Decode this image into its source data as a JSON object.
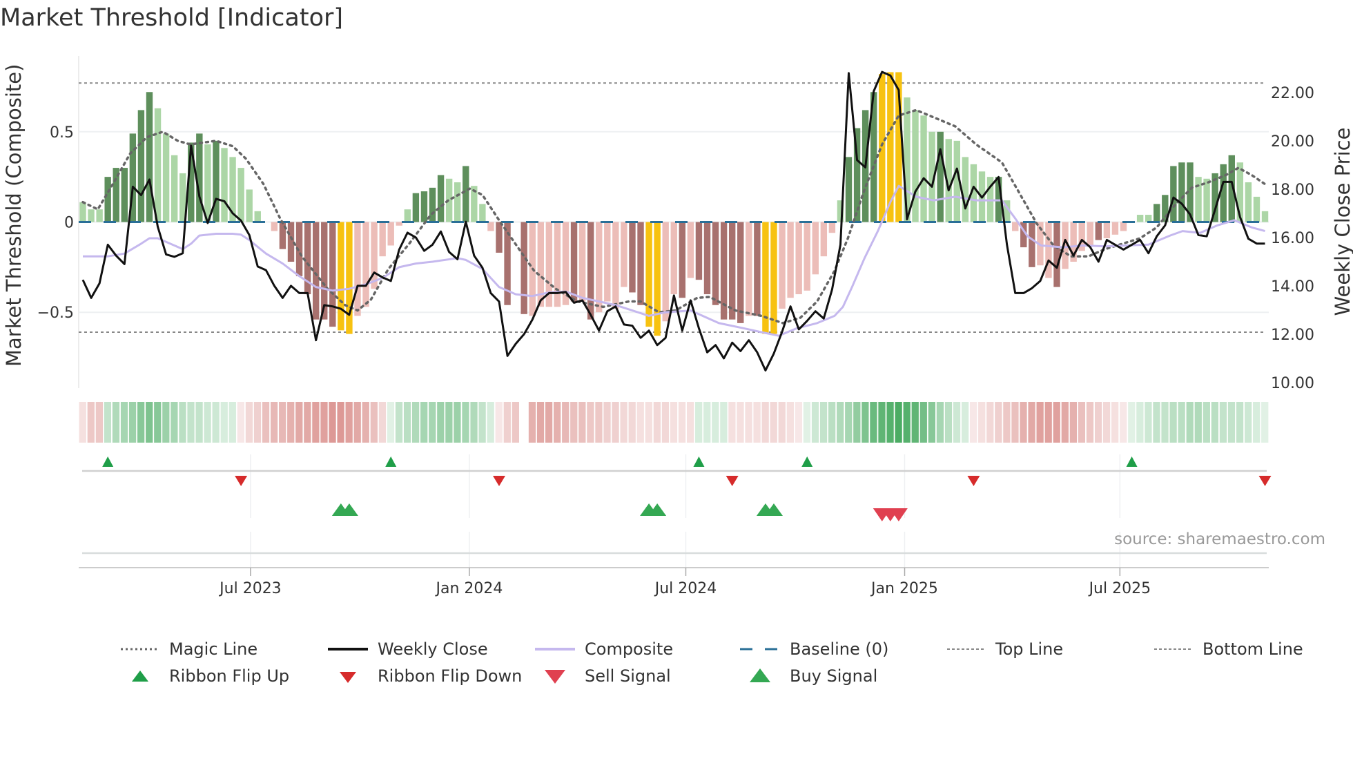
{
  "title": "Market Threshold [Indicator]",
  "source": "source: sharemaestro.com",
  "colors": {
    "bar_dark_green": "#5e8f5c",
    "bar_light_green": "#acd6a6",
    "bar_dark_red": "#a8716e",
    "bar_light_red": "#ecbdb8",
    "bar_yellow": "#f7c211",
    "weekly_close": "#111111",
    "composite": "#c5b8ee",
    "magic_line": "#666666",
    "baseline": "#2a6f97",
    "threshold_lines": "#888888",
    "ribbon_green": "#2e9e4a",
    "ribbon_red": "#c85a55",
    "flip_up": "#1f9e48",
    "flip_down": "#d62b2b",
    "sell": "#e04050",
    "buy": "#34a853"
  },
  "chart_data": {
    "type": "bar+line",
    "title": "Market Threshold [Indicator]",
    "ylabel_left": "Market Threshold (Composite)",
    "ylabel_right": "Weekly Close Price",
    "ylim_left": [
      -0.92,
      0.92
    ],
    "ylim_right": [
      9.77,
      23.51
    ],
    "yticks_left": [
      {
        "value": 0.5,
        "label": "0.5"
      },
      {
        "value": 0,
        "label": "0"
      },
      {
        "value": -0.5,
        "label": "−0.5"
      }
    ],
    "yticks_right": [
      {
        "value": 22,
        "label": "22.00"
      },
      {
        "value": 20,
        "label": "20.00"
      },
      {
        "value": 18,
        "label": "18.00"
      },
      {
        "value": 16,
        "label": "16.00"
      },
      {
        "value": 14,
        "label": "14.00"
      },
      {
        "value": 12,
        "label": "12.00"
      },
      {
        "value": 10,
        "label": "10.00"
      }
    ],
    "xticks": [
      {
        "label": "Jul 2023",
        "date": "2023-07-01"
      },
      {
        "label": "Jan 2024",
        "date": "2024-01-01"
      },
      {
        "label": "Jul 2024",
        "date": "2024-07-01"
      },
      {
        "label": "Jan 2025",
        "date": "2025-01-01"
      },
      {
        "label": "Jul 2025",
        "date": "2025-07-01"
      }
    ],
    "start_date": "2023-02-10",
    "frequency": "weekly",
    "top_line": 0.77,
    "bottom_line": -0.61,
    "baseline": 0,
    "histogram": [
      0.11,
      0.07,
      0.07,
      0.25,
      0.3,
      0.3,
      0.49,
      0.62,
      0.72,
      0.63,
      0.49,
      0.37,
      0.27,
      0.44,
      0.49,
      0.43,
      0.45,
      0.41,
      0.36,
      0.3,
      0.18,
      0.06,
      0,
      -0.05,
      -0.15,
      -0.22,
      -0.3,
      -0.4,
      -0.54,
      -0.54,
      -0.58,
      -0.6,
      -0.62,
      -0.52,
      -0.47,
      -0.37,
      -0.19,
      -0.13,
      -0.02,
      0.07,
      0.16,
      0.17,
      0.19,
      0.26,
      0.24,
      0.22,
      0.31,
      0.2,
      0.1,
      -0.05,
      -0.17,
      -0.46,
      0,
      -0.51,
      -0.52,
      -0.47,
      -0.47,
      -0.47,
      -0.46,
      -0.44,
      -0.44,
      -0.54,
      -0.5,
      -0.44,
      -0.48,
      -0.36,
      -0.39,
      -0.46,
      -0.58,
      -0.63,
      -0.55,
      -0.4,
      -0.42,
      -0.31,
      -0.32,
      -0.4,
      -0.46,
      -0.54,
      -0.54,
      -0.56,
      -0.52,
      -0.52,
      -0.62,
      -0.62,
      -0.48,
      -0.42,
      -0.4,
      -0.38,
      -0.29,
      -0.19,
      -0.06,
      0.12,
      0.36,
      0.52,
      0.62,
      0.72,
      0.82,
      0.83,
      0.83,
      0.69,
      0.62,
      0.59,
      0.5,
      0.5,
      0.46,
      0.45,
      0.36,
      0.32,
      0.28,
      0.25,
      0.25,
      0.12,
      -0.05,
      -0.14,
      -0.25,
      -0.24,
      -0.31,
      -0.36,
      -0.26,
      -0.22,
      -0.16,
      -0.13,
      -0.1,
      -0.09,
      -0.07,
      -0.05,
      0,
      0.04,
      0.04,
      0.1,
      0.15,
      0.31,
      0.33,
      0.33,
      0.25,
      0.24,
      0.27,
      0.32,
      0.37,
      0.33,
      0.22,
      0.14,
      0.06
    ],
    "histogram_shade": "LLLDDDDDDLLLLDDLDLLLLL-LDDDDDDDYYLLLLLLLDDDDLLDLLLDD-DLLLLLDLDLLLLDDYYLLDLDDDDDDLDYYLLLLLLLLDDDDYYYLLLLDLLLLLLDLLDDLLDLLLLDLLL-LLDDDDDLLDDDLLLL",
    "weekly_close": [
      14.25,
      13.5,
      14.1,
      15.7,
      15.25,
      14.9,
      18.1,
      17.75,
      18.4,
      16.45,
      15.3,
      15.2,
      15.35,
      19.8,
      17.7,
      16.6,
      17.6,
      17.5,
      17.0,
      16.7,
      16.1,
      14.8,
      14.65,
      14.0,
      13.5,
      14.0,
      13.7,
      13.7,
      11.75,
      13.2,
      13.15,
      13.05,
      12.8,
      14.0,
      14.0,
      14.55,
      14.35,
      14.2,
      15.5,
      16.2,
      16.0,
      15.45,
      15.7,
      16.25,
      15.4,
      15.1,
      16.65,
      15.25,
      14.75,
      13.7,
      13.35,
      11.1,
      11.6,
      12.0,
      12.6,
      13.4,
      13.7,
      13.7,
      13.75,
      13.3,
      13.4,
      12.8,
      12.15,
      12.95,
      13.15,
      12.4,
      12.35,
      11.85,
      12.15,
      11.55,
      11.85,
      13.6,
      12.15,
      13.4,
      12.25,
      11.25,
      11.55,
      11.0,
      11.65,
      11.3,
      11.75,
      11.25,
      10.5,
      11.2,
      12.1,
      13.15,
      12.2,
      12.55,
      12.95,
      12.65,
      13.85,
      15.7,
      22.8,
      19.2,
      18.9,
      22.05,
      22.85,
      22.7,
      22.1,
      16.75,
      17.9,
      18.45,
      18.1,
      19.65,
      17.95,
      18.85,
      17.2,
      18.1,
      17.65,
      18.1,
      18.5,
      15.7,
      13.7,
      13.7,
      13.9,
      14.2,
      15.05,
      14.75,
      15.9,
      15.25,
      15.9,
      15.6,
      15.0,
      15.9,
      15.7,
      15.5,
      15.7,
      15.9,
      15.35,
      16.05,
      16.5,
      17.65,
      17.4,
      16.95,
      16.1,
      16.05,
      17.15,
      18.3,
      18.3,
      16.85,
      15.95,
      15.75,
      15.75
    ],
    "composite": [
      [
        0,
        -0.19
      ],
      [
        3,
        -0.19
      ],
      [
        5,
        -0.175
      ],
      [
        7,
        -0.12
      ],
      [
        8,
        -0.09
      ],
      [
        9,
        -0.09
      ],
      [
        11,
        -0.13
      ],
      [
        12,
        -0.15
      ],
      [
        13,
        -0.12
      ],
      [
        14,
        -0.075
      ],
      [
        16,
        -0.065
      ],
      [
        18,
        -0.065
      ],
      [
        19,
        -0.07
      ],
      [
        20,
        -0.1
      ],
      [
        22,
        -0.175
      ],
      [
        24,
        -0.23
      ],
      [
        26,
        -0.3
      ],
      [
        28,
        -0.36
      ],
      [
        30,
        -0.38
      ],
      [
        32,
        -0.37
      ],
      [
        34,
        -0.345
      ],
      [
        36,
        -0.31
      ],
      [
        38,
        -0.25
      ],
      [
        40,
        -0.23
      ],
      [
        42,
        -0.22
      ],
      [
        45,
        -0.2
      ],
      [
        46,
        -0.21
      ],
      [
        48,
        -0.26
      ],
      [
        50,
        -0.36
      ],
      [
        52,
        -0.4
      ],
      [
        54,
        -0.41
      ],
      [
        56,
        -0.39
      ],
      [
        58,
        -0.385
      ],
      [
        60,
        -0.42
      ],
      [
        62,
        -0.44
      ],
      [
        64,
        -0.46
      ],
      [
        66,
        -0.49
      ],
      [
        68,
        -0.52
      ],
      [
        70,
        -0.5
      ],
      [
        73,
        -0.49
      ],
      [
        76.4,
        -0.56
      ],
      [
        79.5,
        -0.59
      ],
      [
        81.5,
        -0.61
      ],
      [
        83.6,
        -0.63
      ],
      [
        85.7,
        -0.59
      ],
      [
        88.2,
        -0.56
      ],
      [
        90.3,
        -0.52
      ],
      [
        91.3,
        -0.47
      ],
      [
        92.4,
        -0.36
      ],
      [
        93.9,
        -0.2
      ],
      [
        95.5,
        -0.05
      ],
      [
        97,
        0.11
      ],
      [
        98,
        0.2
      ],
      [
        100.1,
        0.14
      ],
      [
        102.2,
        0.12
      ],
      [
        104.8,
        0.14
      ],
      [
        107.3,
        0.12
      ],
      [
        110.4,
        0.12
      ],
      [
        112,
        0.02
      ],
      [
        113.5,
        -0.08
      ],
      [
        115.1,
        -0.13
      ],
      [
        117.7,
        -0.14
      ],
      [
        120.2,
        -0.13
      ],
      [
        122.8,
        -0.135
      ],
      [
        125.4,
        -0.13
      ],
      [
        128,
        -0.125
      ],
      [
        130.6,
        -0.075
      ],
      [
        132.1,
        -0.05
      ],
      [
        134.2,
        -0.06
      ],
      [
        136.2,
        -0.02
      ],
      [
        138.3,
        0.01
      ],
      [
        140.4,
        -0.03
      ],
      [
        142,
        -0.05
      ]
    ],
    "magic_line": [
      [
        0,
        0.11
      ],
      [
        1.8,
        0.07
      ],
      [
        3.6,
        0.21
      ],
      [
        5.7,
        0.38
      ],
      [
        7.7,
        0.47
      ],
      [
        9.6,
        0.5
      ],
      [
        11.4,
        0.45
      ],
      [
        12.9,
        0.43
      ],
      [
        16,
        0.45
      ],
      [
        18,
        0.42
      ],
      [
        19.6,
        0.35
      ],
      [
        21.7,
        0.21
      ],
      [
        23.7,
        0.02
      ],
      [
        26.3,
        -0.19
      ],
      [
        29.4,
        -0.37
      ],
      [
        31.5,
        -0.46
      ],
      [
        33,
        -0.49
      ],
      [
        34.6,
        -0.43
      ],
      [
        36.7,
        -0.26
      ],
      [
        39.2,
        -0.12
      ],
      [
        41.8,
        0.04
      ],
      [
        43.9,
        0.12
      ],
      [
        46.5,
        0.185
      ],
      [
        48,
        0.15
      ],
      [
        50,
        0.01
      ],
      [
        52.1,
        -0.13
      ],
      [
        54.2,
        -0.27
      ],
      [
        56.8,
        -0.37
      ],
      [
        59.4,
        -0.44
      ],
      [
        62.5,
        -0.47
      ],
      [
        65.6,
        -0.44
      ],
      [
        67,
        -0.44
      ],
      [
        69.2,
        -0.5
      ],
      [
        71.2,
        -0.49
      ],
      [
        73.8,
        -0.42
      ],
      [
        75.3,
        -0.415
      ],
      [
        78.4,
        -0.49
      ],
      [
        81.5,
        -0.52
      ],
      [
        84.1,
        -0.56
      ],
      [
        86.2,
        -0.53
      ],
      [
        88.2,
        -0.44
      ],
      [
        90.3,
        -0.27
      ],
      [
        91.9,
        -0.09
      ],
      [
        93.9,
        0.18
      ],
      [
        96,
        0.43
      ],
      [
        98,
        0.59
      ],
      [
        100.1,
        0.62
      ],
      [
        102.2,
        0.58
      ],
      [
        104.8,
        0.53
      ],
      [
        107.3,
        0.43
      ],
      [
        110.4,
        0.33
      ],
      [
        112.5,
        0.16
      ],
      [
        114.6,
        -0.01
      ],
      [
        116.6,
        -0.13
      ],
      [
        118.7,
        -0.19
      ],
      [
        120.8,
        -0.19
      ],
      [
        122.8,
        -0.15
      ],
      [
        124.9,
        -0.12
      ],
      [
        127,
        -0.09
      ],
      [
        129,
        -0.03
      ],
      [
        131.1,
        0.09
      ],
      [
        133.2,
        0.19
      ],
      [
        135.2,
        0.22
      ],
      [
        137.3,
        0.26
      ],
      [
        138.8,
        0.3
      ],
      [
        140.4,
        0.26
      ],
      [
        142,
        0.21
      ]
    ],
    "ribbon": [
      -0.2,
      -0.35,
      -0.35,
      0.3,
      0.4,
      0.45,
      0.5,
      0.6,
      0.65,
      0.6,
      0.5,
      0.45,
      0.35,
      0.3,
      0.3,
      0.25,
      0.25,
      0.2,
      0.2,
      -0.15,
      -0.25,
      -0.3,
      -0.4,
      -0.45,
      -0.45,
      -0.5,
      -0.55,
      -0.55,
      -0.6,
      -0.6,
      -0.65,
      -0.65,
      -0.6,
      -0.55,
      -0.5,
      -0.4,
      -0.25,
      0.15,
      0.3,
      0.35,
      0.4,
      0.45,
      0.45,
      0.5,
      0.5,
      0.5,
      0.45,
      0.4,
      0.3,
      0.2,
      -0.15,
      -0.3,
      -0.35,
      null,
      -0.5,
      -0.55,
      -0.55,
      -0.5,
      -0.45,
      -0.4,
      -0.4,
      -0.35,
      -0.35,
      -0.3,
      -0.3,
      -0.25,
      -0.25,
      -0.2,
      -0.2,
      -0.25,
      -0.25,
      -0.2,
      -0.2,
      -0.2,
      0.2,
      0.2,
      0.2,
      0.2,
      -0.2,
      -0.2,
      -0.2,
      -0.2,
      -0.25,
      -0.25,
      -0.25,
      -0.2,
      -0.15,
      0.15,
      0.25,
      0.3,
      0.35,
      0.4,
      0.45,
      0.55,
      0.65,
      0.75,
      0.8,
      0.85,
      0.9,
      0.85,
      0.8,
      0.7,
      0.6,
      0.45,
      0.35,
      0.25,
      0.2,
      -0.15,
      -0.2,
      -0.25,
      -0.3,
      -0.35,
      -0.4,
      -0.5,
      -0.55,
      -0.6,
      -0.6,
      -0.6,
      -0.55,
      -0.5,
      -0.4,
      -0.35,
      -0.3,
      -0.25,
      -0.2,
      -0.15,
      0.15,
      0.2,
      0.25,
      0.3,
      0.3,
      0.35,
      0.35,
      0.4,
      0.4,
      0.35,
      0.35,
      0.3,
      0.3,
      0.3,
      0.25,
      0.2,
      0.15
    ],
    "ribbon_flip_up": [
      3,
      37,
      74,
      87,
      126
    ],
    "ribbon_flip_down": [
      19,
      50,
      78,
      107,
      142
    ],
    "buy_signal": [
      31,
      32,
      68,
      69,
      82,
      83
    ],
    "sell_signal": [
      96,
      97,
      98
    ]
  },
  "legend": {
    "row1": [
      "Magic Line",
      "Weekly Close",
      "Composite",
      "Baseline (0)",
      "Top Line",
      "Bottom Line"
    ],
    "row2": [
      "Ribbon Flip Up",
      "Ribbon Flip Down",
      "Sell Signal",
      "Buy Signal"
    ]
  }
}
